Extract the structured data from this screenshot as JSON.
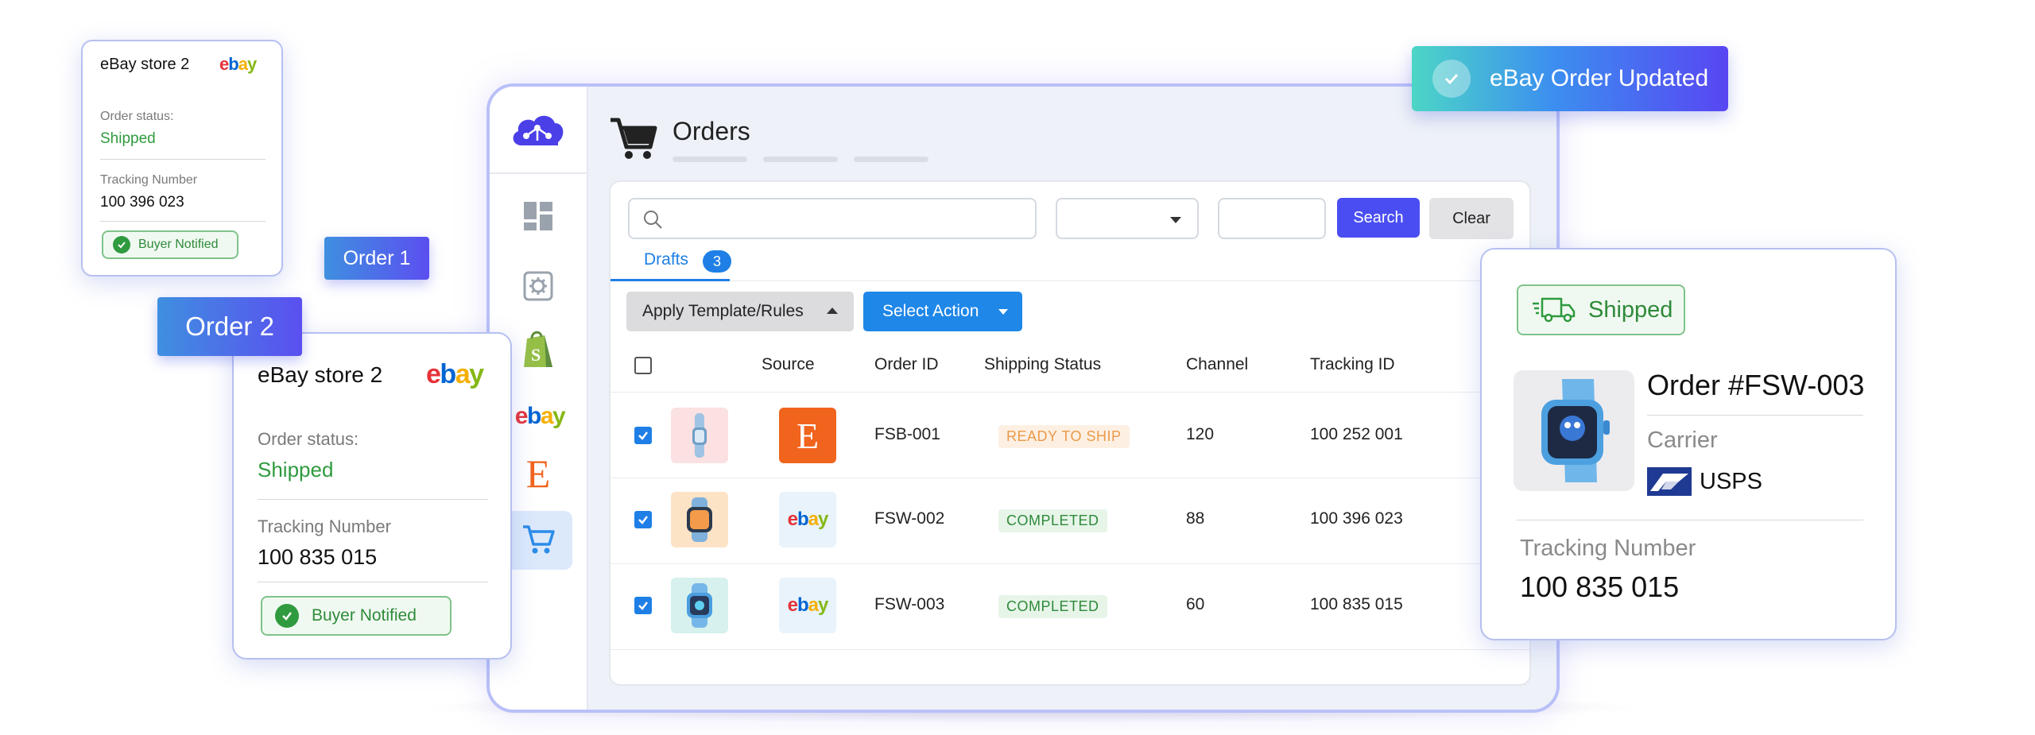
{
  "main": {
    "title": "Orders",
    "search_button": "Search",
    "clear_button": "Clear",
    "tab_label": "Drafts",
    "tab_count": "3",
    "apply_button": "Apply Template/Rules",
    "action_button": "Select Action",
    "columns": [
      "Source",
      "Order ID",
      "Shipping Status",
      "Channel",
      "Tracking ID"
    ],
    "rows": [
      {
        "order_id": "FSB-001",
        "source": "etsy",
        "status": "READY TO SHIP",
        "channel": "120",
        "tracking": "100 252 001"
      },
      {
        "order_id": "FSW-002",
        "source": "ebay",
        "status": "COMPLETED",
        "channel": "88",
        "tracking": "100 396 023"
      },
      {
        "order_id": "FSW-003",
        "source": "ebay",
        "status": "COMPLETED",
        "channel": "60",
        "tracking": "100 835 015"
      }
    ]
  },
  "card_small": {
    "store": "eBay store 2",
    "status_label": "Order status:",
    "status_value": "Shipped",
    "tracking_label": "Tracking Number",
    "tracking_value": "100 396 023",
    "notified": "Buyer Notified"
  },
  "card_medium": {
    "store": "eBay store 2",
    "status_label": "Order status:",
    "status_value": "Shipped",
    "tracking_label": "Tracking Number",
    "tracking_value": "100 835 015",
    "notified": "Buyer Notified"
  },
  "tags": {
    "order1": "Order 1",
    "order2": "Order 2"
  },
  "toast": {
    "text": "eBay Order Updated"
  },
  "card_right": {
    "shipped": "Shipped",
    "order": "Order #FSW-003",
    "carrier_label": "Carrier",
    "carrier_value": "USPS",
    "tracking_label": "Tracking Number",
    "tracking_value": "100 835 015"
  },
  "brand": {
    "ebay": "ebay",
    "etsy": "E"
  },
  "colors": {
    "accent": "#4a4ef2",
    "blue": "#1f7fe6",
    "green": "#2f9a3e",
    "ready_bg": "#fdf0e3",
    "ready_text": "#e99a4a",
    "completed_bg": "#e7f5e9",
    "completed_text": "#2f8a3a"
  }
}
